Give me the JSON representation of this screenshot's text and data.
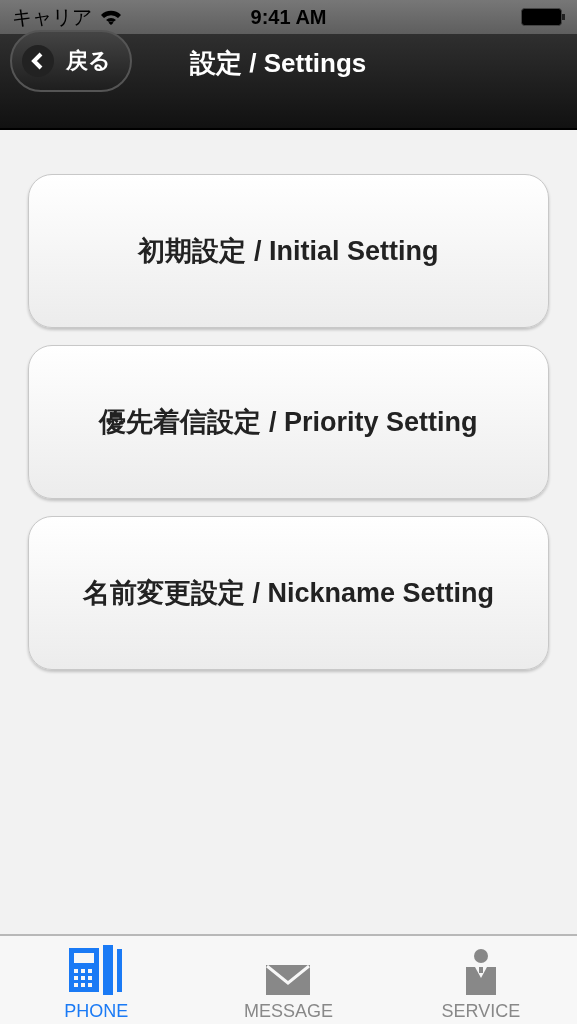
{
  "status_bar": {
    "carrier": "キャリア",
    "time": "9:41 AM"
  },
  "nav_bar": {
    "back_button": "戻る",
    "title": "設定 / Settings"
  },
  "menu_items": [
    {
      "label": "初期設定 / Initial Setting"
    },
    {
      "label": "優先着信設定 / Priority Setting"
    },
    {
      "label": "名前変更設定 / Nickname Setting"
    }
  ],
  "tab_bar": [
    {
      "kind": "phone",
      "label": "PHONE",
      "selected": true
    },
    {
      "kind": "message",
      "label": "MESSAGE",
      "selected": false
    },
    {
      "kind": "service",
      "label": "SERVICE",
      "selected": false
    }
  ]
}
